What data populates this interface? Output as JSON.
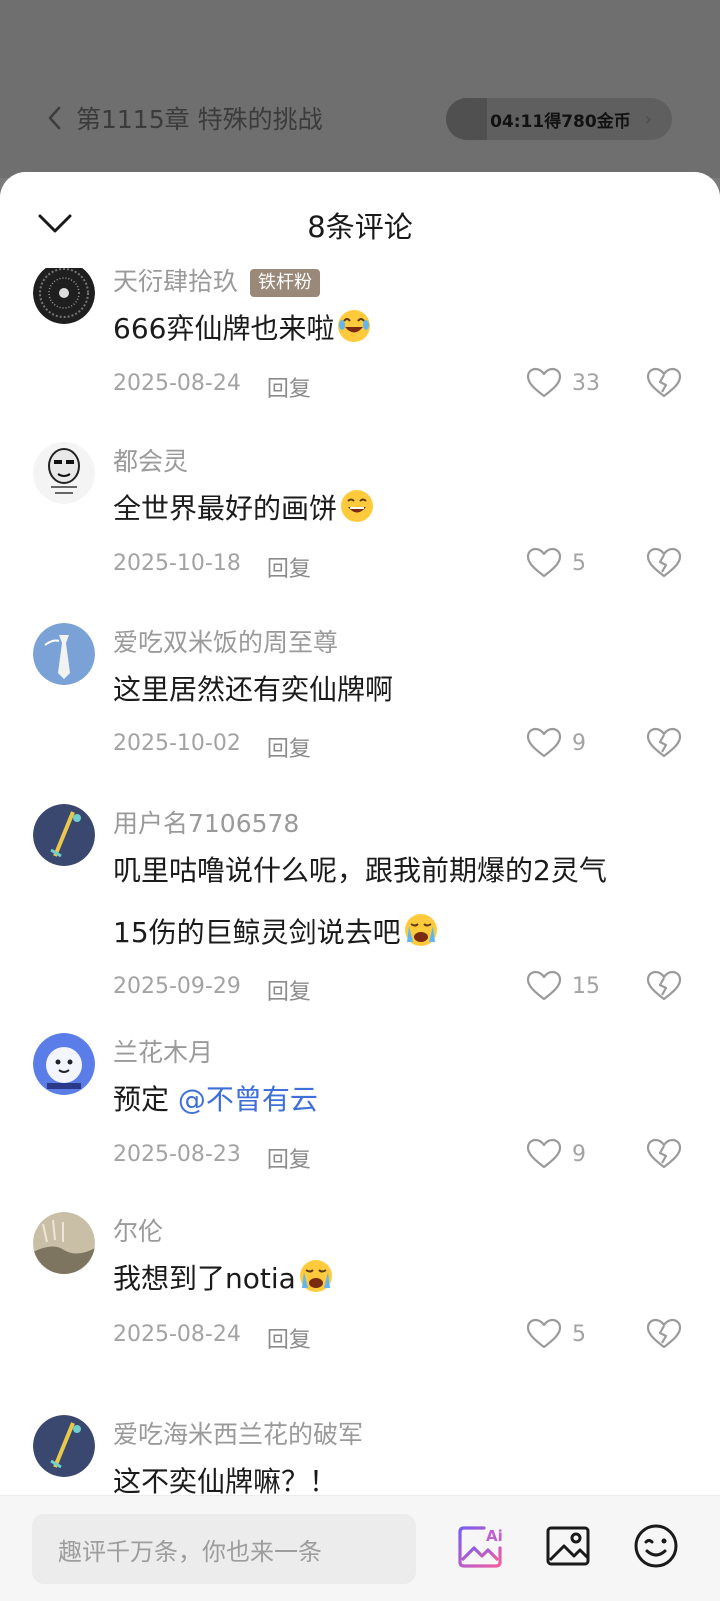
{
  "header": {
    "chapter_title": "第1115章 特殊的挑战",
    "reward_text": "04:11得780金币",
    "reward_progress": 0.18
  },
  "sheet": {
    "title": "8条评论"
  },
  "comments": [
    {
      "username": "天衍肆拾玖",
      "badge": "铁杆粉",
      "text": "666弈仙牌也来啦",
      "emoji": "laughing-tears-emoji",
      "date": "2025-08-24",
      "reply": "回复",
      "likes": "33"
    },
    {
      "username": "都会灵",
      "text": "全世界最好的画饼",
      "emoji": "grinning-emoji",
      "date": "2025-10-18",
      "reply": "回复",
      "likes": "5"
    },
    {
      "username": "爱吃双米饭的周至尊",
      "text": "这里居然还有奕仙牌啊",
      "date": "2025-10-02",
      "reply": "回复",
      "likes": "9"
    },
    {
      "username": "用户名7106578",
      "text_line1": "叽里咕噜说什么呢，跟我前期爆的2灵气",
      "text_line2": "15伤的巨鲸灵剑说去吧",
      "emoji": "crying-emoji",
      "date": "2025-09-29",
      "reply": "回复",
      "likes": "15"
    },
    {
      "username": "兰花木月",
      "text": "预定 ",
      "mention": "@不曾有云",
      "date": "2025-08-23",
      "reply": "回复",
      "likes": "9"
    },
    {
      "username": "尔伦",
      "text": "我想到了notia",
      "emoji": "crying-emoji",
      "date": "2025-08-24",
      "reply": "回复",
      "likes": "5"
    },
    {
      "username": "爱吃海米西兰花的破军",
      "text": "这不奕仙牌嘛？！"
    }
  ],
  "bottom": {
    "input_placeholder": "趣评千万条，你也来一条"
  },
  "colors": {
    "mention": "#3f6fd8",
    "ai_icon_gradient": [
      "#7a5cf0",
      "#f05fa0"
    ]
  }
}
